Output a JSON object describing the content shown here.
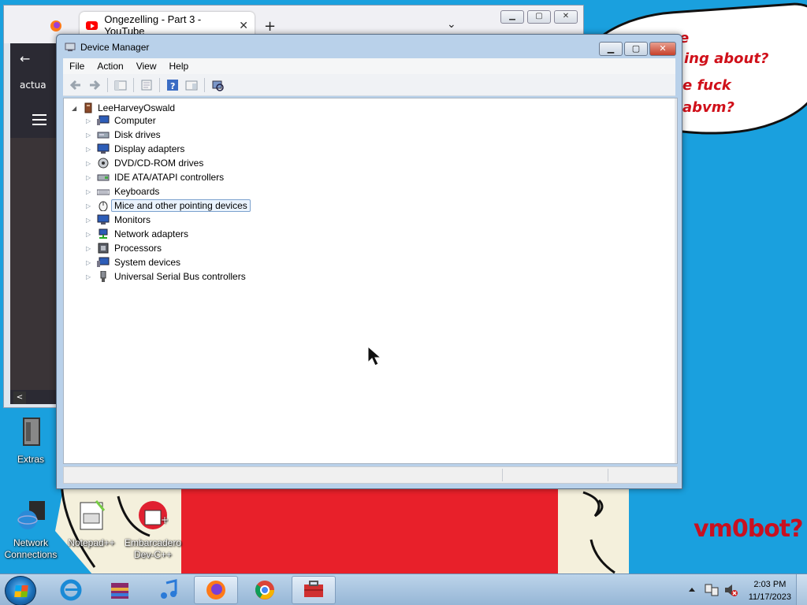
{
  "firefox": {
    "tab_title": "Ongezelling - Part 3 - YouTube",
    "tab_close": "✕",
    "new_tab": "+",
    "tab_list": "⌄",
    "sidebar_text": "actua",
    "back": "←",
    "scroll_left": "<"
  },
  "wallpaper": {
    "bubble_lines": [
      "e",
      "ing about?",
      "e fuck",
      "abvm?"
    ],
    "corner_text": "vm0bot?"
  },
  "desktop_icons": [
    {
      "label": "Extras",
      "icon": "folder-icon"
    },
    {
      "label": "Network Connections",
      "icon": "network-icon"
    },
    {
      "label": "Notepad++",
      "icon": "notepad-icon"
    },
    {
      "label": "Embarcadero Dev-C++",
      "icon": "devcpp-icon"
    }
  ],
  "device_manager": {
    "title": "Device Manager",
    "menu": [
      "File",
      "Action",
      "View",
      "Help"
    ],
    "root": "LeeHarveyOswald",
    "categories": [
      {
        "label": "Computer",
        "icon": "computer-icon"
      },
      {
        "label": "Disk drives",
        "icon": "disk-icon"
      },
      {
        "label": "Display adapters",
        "icon": "display-icon"
      },
      {
        "label": "DVD/CD-ROM drives",
        "icon": "dvd-icon"
      },
      {
        "label": "IDE ATA/ATAPI controllers",
        "icon": "ide-icon"
      },
      {
        "label": "Keyboards",
        "icon": "keyboard-icon"
      },
      {
        "label": "Mice and other pointing devices",
        "icon": "mouse-icon",
        "selected": true
      },
      {
        "label": "Monitors",
        "icon": "monitor-icon"
      },
      {
        "label": "Network adapters",
        "icon": "network-adapter-icon"
      },
      {
        "label": "Processors",
        "icon": "processor-icon"
      },
      {
        "label": "System devices",
        "icon": "system-icon"
      },
      {
        "label": "Universal Serial Bus controllers",
        "icon": "usb-icon"
      }
    ]
  },
  "taskbar": {
    "apps": [
      "internet-explorer-icon",
      "winrar-icon",
      "itunes-icon",
      "firefox-icon",
      "chrome-icon",
      "device-manager-icon"
    ],
    "time": "2:03 PM",
    "date": "11/17/2023"
  },
  "colors": {
    "desktop": "#1aa0de",
    "window_frame": "#b9d1ea",
    "selection": "#eaf3fd"
  }
}
